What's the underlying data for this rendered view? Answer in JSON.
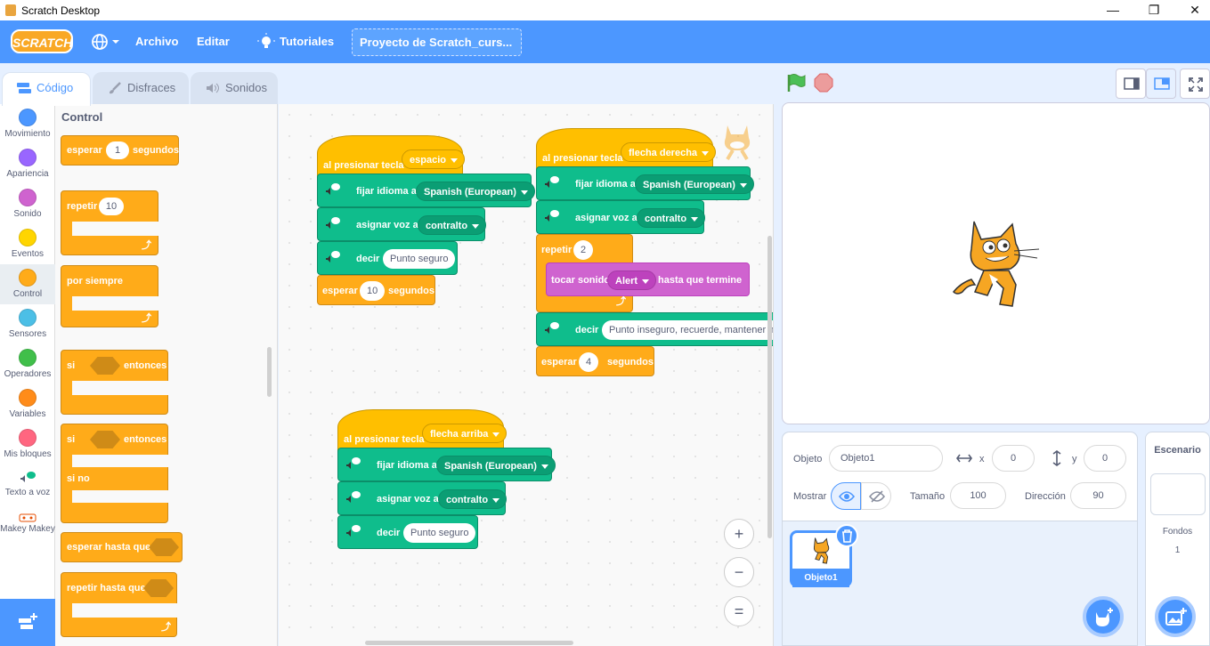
{
  "window": {
    "title": "Scratch Desktop",
    "minimize": "—",
    "maximize": "❐",
    "close": "✕"
  },
  "menubar": {
    "logo": "SCRATCH",
    "file": "Archivo",
    "edit": "Editar",
    "tutorials": "Tutoriales",
    "project_title": "Proyecto de Scratch_curs..."
  },
  "tabs": {
    "code": "Código",
    "costumes": "Disfraces",
    "sounds": "Sonidos"
  },
  "categories": [
    {
      "label": "Movimiento",
      "color": "#4c97ff"
    },
    {
      "label": "Apariencia",
      "color": "#9966ff"
    },
    {
      "label": "Sonido",
      "color": "#cf63cf"
    },
    {
      "label": "Eventos",
      "color": "#ffd500"
    },
    {
      "label": "Control",
      "color": "#ffab19"
    },
    {
      "label": "Sensores",
      "color": "#4cbfe6"
    },
    {
      "label": "Operadores",
      "color": "#40bf4a"
    },
    {
      "label": "Variables",
      "color": "#ff8c1a"
    },
    {
      "label": "Mis bloques",
      "color": "#ff6680"
    },
    {
      "label": "Texto a voz",
      "color": "#0fbd8c"
    },
    {
      "label": "Makey Makey",
      "color": "#e64d00"
    }
  ],
  "palette": {
    "title": "Control",
    "wait_a": "esperar",
    "wait_val": "1",
    "wait_b": "segundos",
    "repeat": "repetir",
    "repeat_val": "10",
    "forever": "por siempre",
    "if": "si",
    "then": "entonces",
    "if2": "si",
    "then2": "entonces",
    "else": "si no",
    "wait_until": "esperar hasta que",
    "repeat_until": "repetir hasta que"
  },
  "script1": {
    "hat": "al presionar tecla",
    "key": "espacio",
    "lang": "fijar idioma a",
    "lang_val": "Spanish (European)",
    "voice": "asignar voz a",
    "voice_val": "contralto",
    "say": "decir",
    "say_val": "Punto seguro",
    "wait_a": "esperar",
    "wait_val": "10",
    "wait_b": "segundos"
  },
  "script2": {
    "hat": "al presionar tecla",
    "key": "flecha derecha",
    "lang": "fijar idioma a",
    "lang_val": "Spanish (European)",
    "voice": "asignar voz a",
    "voice_val": "contralto",
    "repeat": "repetir",
    "repeat_val": "2",
    "sound": "tocar sonido",
    "sound_val": "Alert",
    "sound_b": "hasta que termine",
    "say": "decir",
    "say_val": "Punto inseguro, recuerde, mantener n",
    "wait_a": "esperar",
    "wait_val": "4",
    "wait_b": "segundos"
  },
  "script3": {
    "hat": "al presionar tecla",
    "key": "flecha arriba",
    "lang": "fijar idioma a",
    "lang_val": "Spanish (European)",
    "voice": "asignar voz a",
    "voice_val": "contralto",
    "say": "decir",
    "say_val": "Punto seguro"
  },
  "zoom": {
    "in": "+",
    "out": "−",
    "reset": "="
  },
  "sprite_info": {
    "sprite_label": "Objeto",
    "sprite_name": "Objeto1",
    "x_label": "x",
    "x_val": "0",
    "y_label": "y",
    "y_val": "0",
    "show_label": "Mostrar",
    "size_label": "Tamaño",
    "size_val": "100",
    "direction_label": "Dirección",
    "direction_val": "90"
  },
  "sprites": [
    {
      "name": "Objeto1"
    }
  ],
  "stage_pane": {
    "title": "Escenario",
    "backdrops_label": "Fondos",
    "backdrops_count": "1"
  }
}
